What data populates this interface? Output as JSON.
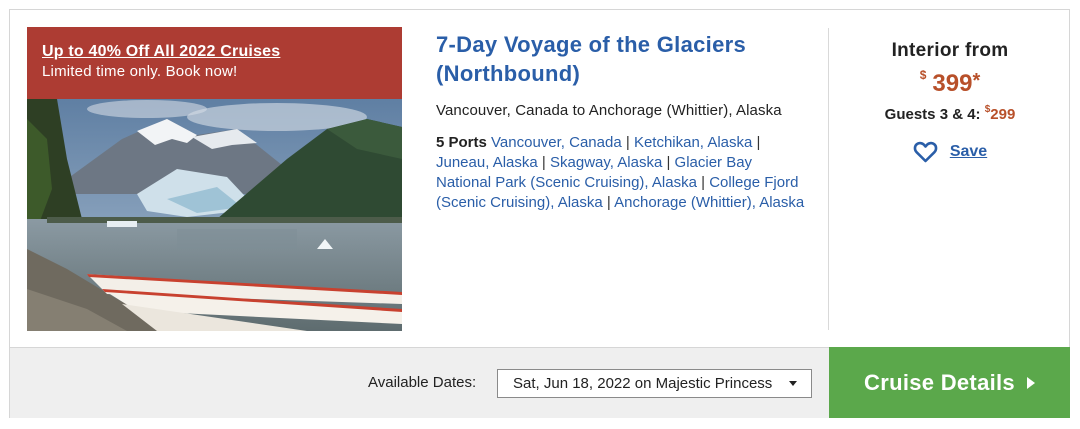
{
  "promo": {
    "title": "Up to 40% Off All 2022 Cruises",
    "subtitle": "Limited time only. Book now!",
    "color": "#ad3c33"
  },
  "cruise": {
    "title": "7-Day Voyage of the Glaciers (Northbound)",
    "route": "Vancouver, Canada to Anchorage (Whittier), Alaska",
    "ports_count_label": "5 Ports",
    "ports": [
      "Vancouver, Canada",
      "Ketchikan, Alaska",
      "Juneau, Alaska",
      "Skagway, Alaska",
      "Glacier Bay National Park (Scenic Cruising), Alaska",
      "College Fjord (Scenic Cruising), Alaska",
      "Anchorage (Whittier), Alaska"
    ]
  },
  "pricing": {
    "label": "Interior from",
    "currency": "$",
    "amount": "399",
    "asterisk": "*",
    "guests_label": "Guests 3 & 4:",
    "guests_currency": "$",
    "guests_amount": "299",
    "price_color": "#b8502a"
  },
  "save": {
    "label": "Save",
    "icon": "heart-outline-icon"
  },
  "footer": {
    "dates_label": "Available Dates:",
    "selected_date": "Sat, Jun 18, 2022 on Majestic Princess",
    "details_button": "Cruise Details",
    "button_color": "#5ba84b"
  },
  "colors": {
    "link": "#2a5ea8"
  }
}
